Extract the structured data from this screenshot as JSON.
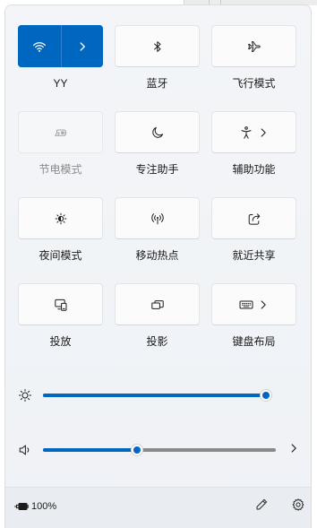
{
  "tiles": [
    {
      "label": "YY",
      "icon": "wifi-icon",
      "more_icon": "chevron-right-icon",
      "active": true,
      "disabled": false
    },
    {
      "label": "蓝牙",
      "icon": "bluetooth-icon",
      "active": false,
      "disabled": false
    },
    {
      "label": "飞行模式",
      "icon": "airplane-icon",
      "active": false,
      "disabled": false
    },
    {
      "label": "节电模式",
      "icon": "battery-saver-icon",
      "active": false,
      "disabled": true
    },
    {
      "label": "专注助手",
      "icon": "moon-icon",
      "active": false,
      "disabled": false
    },
    {
      "label": "辅助功能",
      "icon": "accessibility-icon",
      "more_icon": "chevron-right-icon",
      "active": false,
      "disabled": false
    },
    {
      "label": "夜间模式",
      "icon": "night-light-icon",
      "active": false,
      "disabled": false
    },
    {
      "label": "移动热点",
      "icon": "mobile-hotspot-icon",
      "active": false,
      "disabled": false
    },
    {
      "label": "就近共享",
      "icon": "nearby-share-icon",
      "active": false,
      "disabled": false
    },
    {
      "label": "投放",
      "icon": "cast-icon",
      "active": false,
      "disabled": false
    },
    {
      "label": "投影",
      "icon": "project-icon",
      "active": false,
      "disabled": false
    },
    {
      "label": "键盘布局",
      "icon": "keyboard-icon",
      "more_icon": "chevron-right-icon",
      "active": false,
      "disabled": false
    }
  ],
  "brightness": {
    "icon": "brightness-icon",
    "value": 100
  },
  "volume": {
    "icon": "speaker-icon",
    "value": 40,
    "more_icon": "chevron-right-icon"
  },
  "footer": {
    "battery_icon": "battery-charging-icon",
    "battery_text": "100%",
    "edit_icon": "pencil-icon",
    "settings_icon": "gear-icon"
  },
  "colors": {
    "accent": "#0067c0",
    "track": "#8a8a8a",
    "disabled_text": "#8a8a8a"
  }
}
